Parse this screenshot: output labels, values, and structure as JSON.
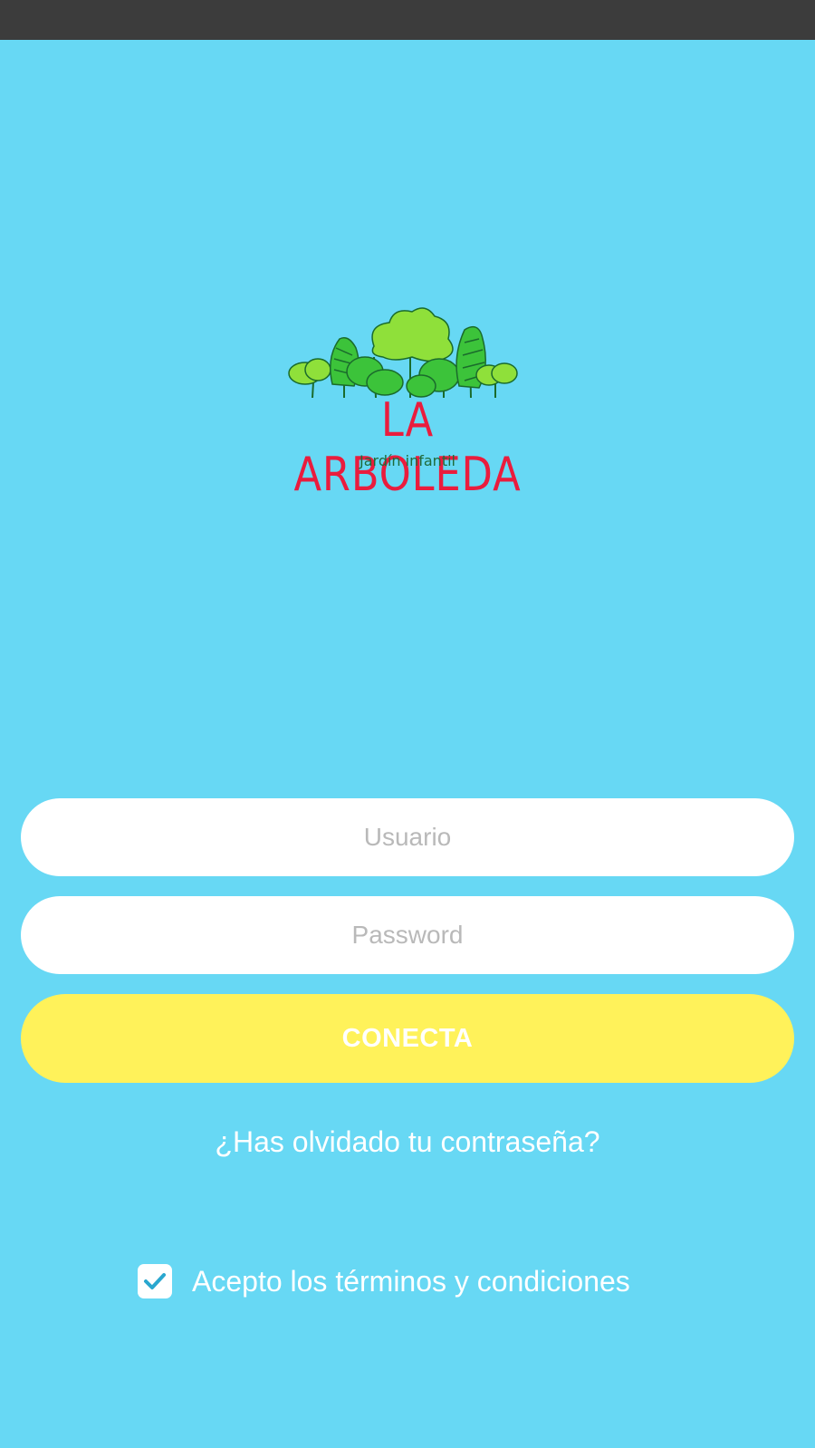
{
  "logo": {
    "title": "LA ARBOLEDA",
    "subtitle": "Jardín infantil",
    "colors": {
      "title": "#ea1c3d",
      "subtitle": "#1f6b3a",
      "leaf_light": "#8fe03a",
      "leaf_mid": "#3cc33a",
      "leaf_dark": "#1f8a2d",
      "trunk": "#1a6b2c"
    }
  },
  "login": {
    "username_placeholder": "Usuario",
    "username_value": "",
    "password_placeholder": "Password",
    "password_value": "",
    "connect_label": "CONECTA",
    "forgot_password": "¿Has olvidado tu contraseña?"
  },
  "terms": {
    "label": "Acepto los términos y condiciones",
    "checked": true,
    "icon": "checkmark-icon"
  },
  "colors": {
    "background": "#67d8f4",
    "status_bar": "#3c3c3c",
    "button": "#fff25a",
    "button_text": "#ffffff",
    "field": "#ffffff",
    "placeholder": "#b9b9b9",
    "checkmark": "#2aa7cf"
  }
}
